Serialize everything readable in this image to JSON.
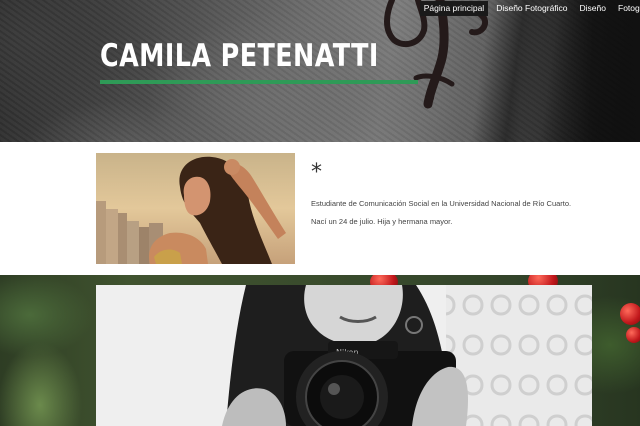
{
  "nav": {
    "items": [
      {
        "label": "Página principal",
        "active": true
      },
      {
        "label": "Diseño Fotográfico",
        "active": false
      },
      {
        "label": "Diseño",
        "active": false
      },
      {
        "label": "Fotogra",
        "active": false
      }
    ]
  },
  "hero": {
    "title": "CAMILA PETENATTI",
    "underline_color": "#2f9a57"
  },
  "profile": {
    "heading": "*",
    "bio_line_1": "Estudiante de Comunicación Social en la Universidad Nacional de Río Cuarto.",
    "bio_line_2": "Nací un 24 de julio. Hija y hermana mayor."
  },
  "colors": {
    "accent": "#2f9a57",
    "nav_active_bg": "#1a1a1a"
  }
}
